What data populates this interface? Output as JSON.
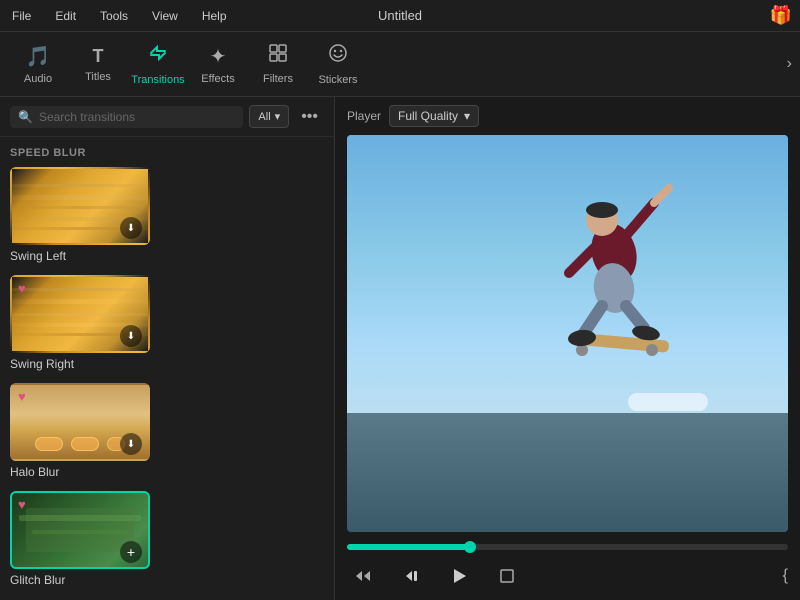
{
  "menuBar": {
    "items": [
      "File",
      "Edit",
      "Tools",
      "View",
      "Help"
    ],
    "title": "Untitled",
    "giftIcon": "🎁"
  },
  "toolbar": {
    "items": [
      {
        "id": "audio",
        "label": "Audio",
        "icon": "♪"
      },
      {
        "id": "titles",
        "label": "Titles",
        "icon": "T"
      },
      {
        "id": "transitions",
        "label": "Transitions",
        "icon": "↔",
        "active": true
      },
      {
        "id": "effects",
        "label": "Effects",
        "icon": "✦"
      },
      {
        "id": "filters",
        "label": "Filters",
        "icon": "⊞"
      },
      {
        "id": "stickers",
        "label": "Stickers",
        "icon": "😊"
      }
    ],
    "chevron": "›"
  },
  "leftPanel": {
    "searchPlaceholder": "Search transitions",
    "filterLabel": "All",
    "sectionLabel": "SPEED BLUR",
    "transitions": [
      {
        "id": "swing-left",
        "name": "Swing Left",
        "hasHeart": false,
        "hasDownload": true,
        "selected": false,
        "thumbStyle": "blur-1"
      },
      {
        "id": "swing-right",
        "name": "Swing Right",
        "hasHeart": true,
        "hasDownload": true,
        "selected": false,
        "thumbStyle": "blur-2"
      },
      {
        "id": "halo-blur",
        "name": "Halo Blur",
        "hasHeart": true,
        "hasDownload": true,
        "selected": false,
        "thumbStyle": "blur-3"
      },
      {
        "id": "glitch-blur",
        "name": "Glitch Blur",
        "hasHeart": true,
        "hasAdd": true,
        "selected": true,
        "thumbStyle": "blur-4"
      }
    ]
  },
  "rightPanel": {
    "playerLabel": "Player",
    "qualityLabel": "Full Quality",
    "progress": 28,
    "controls": {
      "rewind": "⏮",
      "stepBack": "⏪",
      "play": "▶",
      "stop": "⏹",
      "extra": "{"
    }
  }
}
